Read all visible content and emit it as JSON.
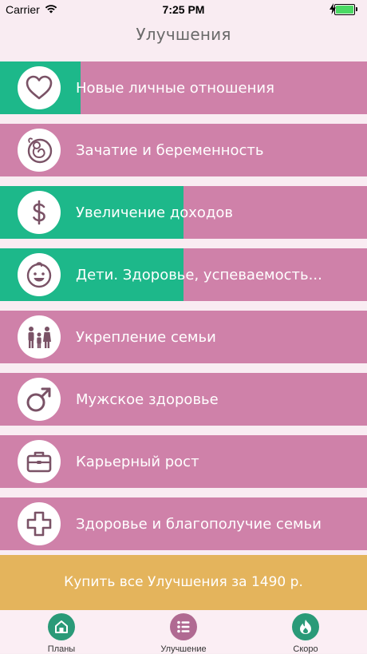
{
  "status_bar": {
    "carrier": "Carrier",
    "time": "7:25 PM"
  },
  "header": {
    "title": "Улучшения"
  },
  "items": [
    {
      "label": "Новые личные отношения",
      "icon": "heart-icon",
      "progress": 0.22
    },
    {
      "label": "Зачатие и беременность",
      "icon": "embryo-icon",
      "progress": 0
    },
    {
      "label": "Увеличение доходов",
      "icon": "dollar-icon",
      "progress": 0.5
    },
    {
      "label": "Дети. Здоровье, успеваемость...",
      "icon": "child-face-icon",
      "progress": 0.5
    },
    {
      "label": "Укрепление семьи",
      "icon": "family-icon",
      "progress": 0
    },
    {
      "label": "Мужское здоровье",
      "icon": "male-symbol-icon",
      "progress": 0
    },
    {
      "label": "Карьерный рост",
      "icon": "briefcase-icon",
      "progress": 0
    },
    {
      "label": "Здоровье и благополучие семьи",
      "icon": "medical-cross-icon",
      "progress": 0
    }
  ],
  "buy_button": {
    "label": "Купить все Улучшения за 1490 р."
  },
  "tabbar": {
    "tabs": [
      {
        "label": "Планы",
        "icon": "home-icon",
        "color": "#2a9a78"
      },
      {
        "label": "Улучшение",
        "icon": "list-icon",
        "color": "#b06a92"
      },
      {
        "label": "Скоро",
        "icon": "flame-icon",
        "color": "#2a9a78"
      }
    ]
  },
  "colors": {
    "row_background": "#cf81a9",
    "progress_fill": "#1db88a",
    "buy_button": "#e4b45c",
    "page_background": "#f9ecf2",
    "icon_stroke": "#7a5266"
  }
}
